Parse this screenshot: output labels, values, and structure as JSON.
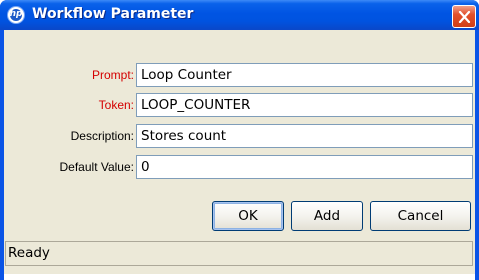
{
  "window": {
    "title": "Workflow Parameter",
    "logo_text": "hp",
    "title_color": "#0054e3"
  },
  "fields": [
    {
      "label": "Prompt:",
      "value": "Loop Counter",
      "required": true
    },
    {
      "label": "Token:",
      "value": "LOOP_COUNTER",
      "required": true
    },
    {
      "label": "Description:",
      "value": "Stores count",
      "required": false
    },
    {
      "label": "Default Value:",
      "value": "0",
      "required": false
    }
  ],
  "buttons": {
    "ok": "OK",
    "add": "Add",
    "cancel": "Cancel"
  },
  "status": {
    "text": "Ready"
  },
  "colors": {
    "required_label": "#d40000",
    "dialog_background": "#ece9d8",
    "input_border": "#7f9db9"
  },
  "icons": {
    "logo": "hp-logo-icon",
    "close": "close-icon"
  }
}
